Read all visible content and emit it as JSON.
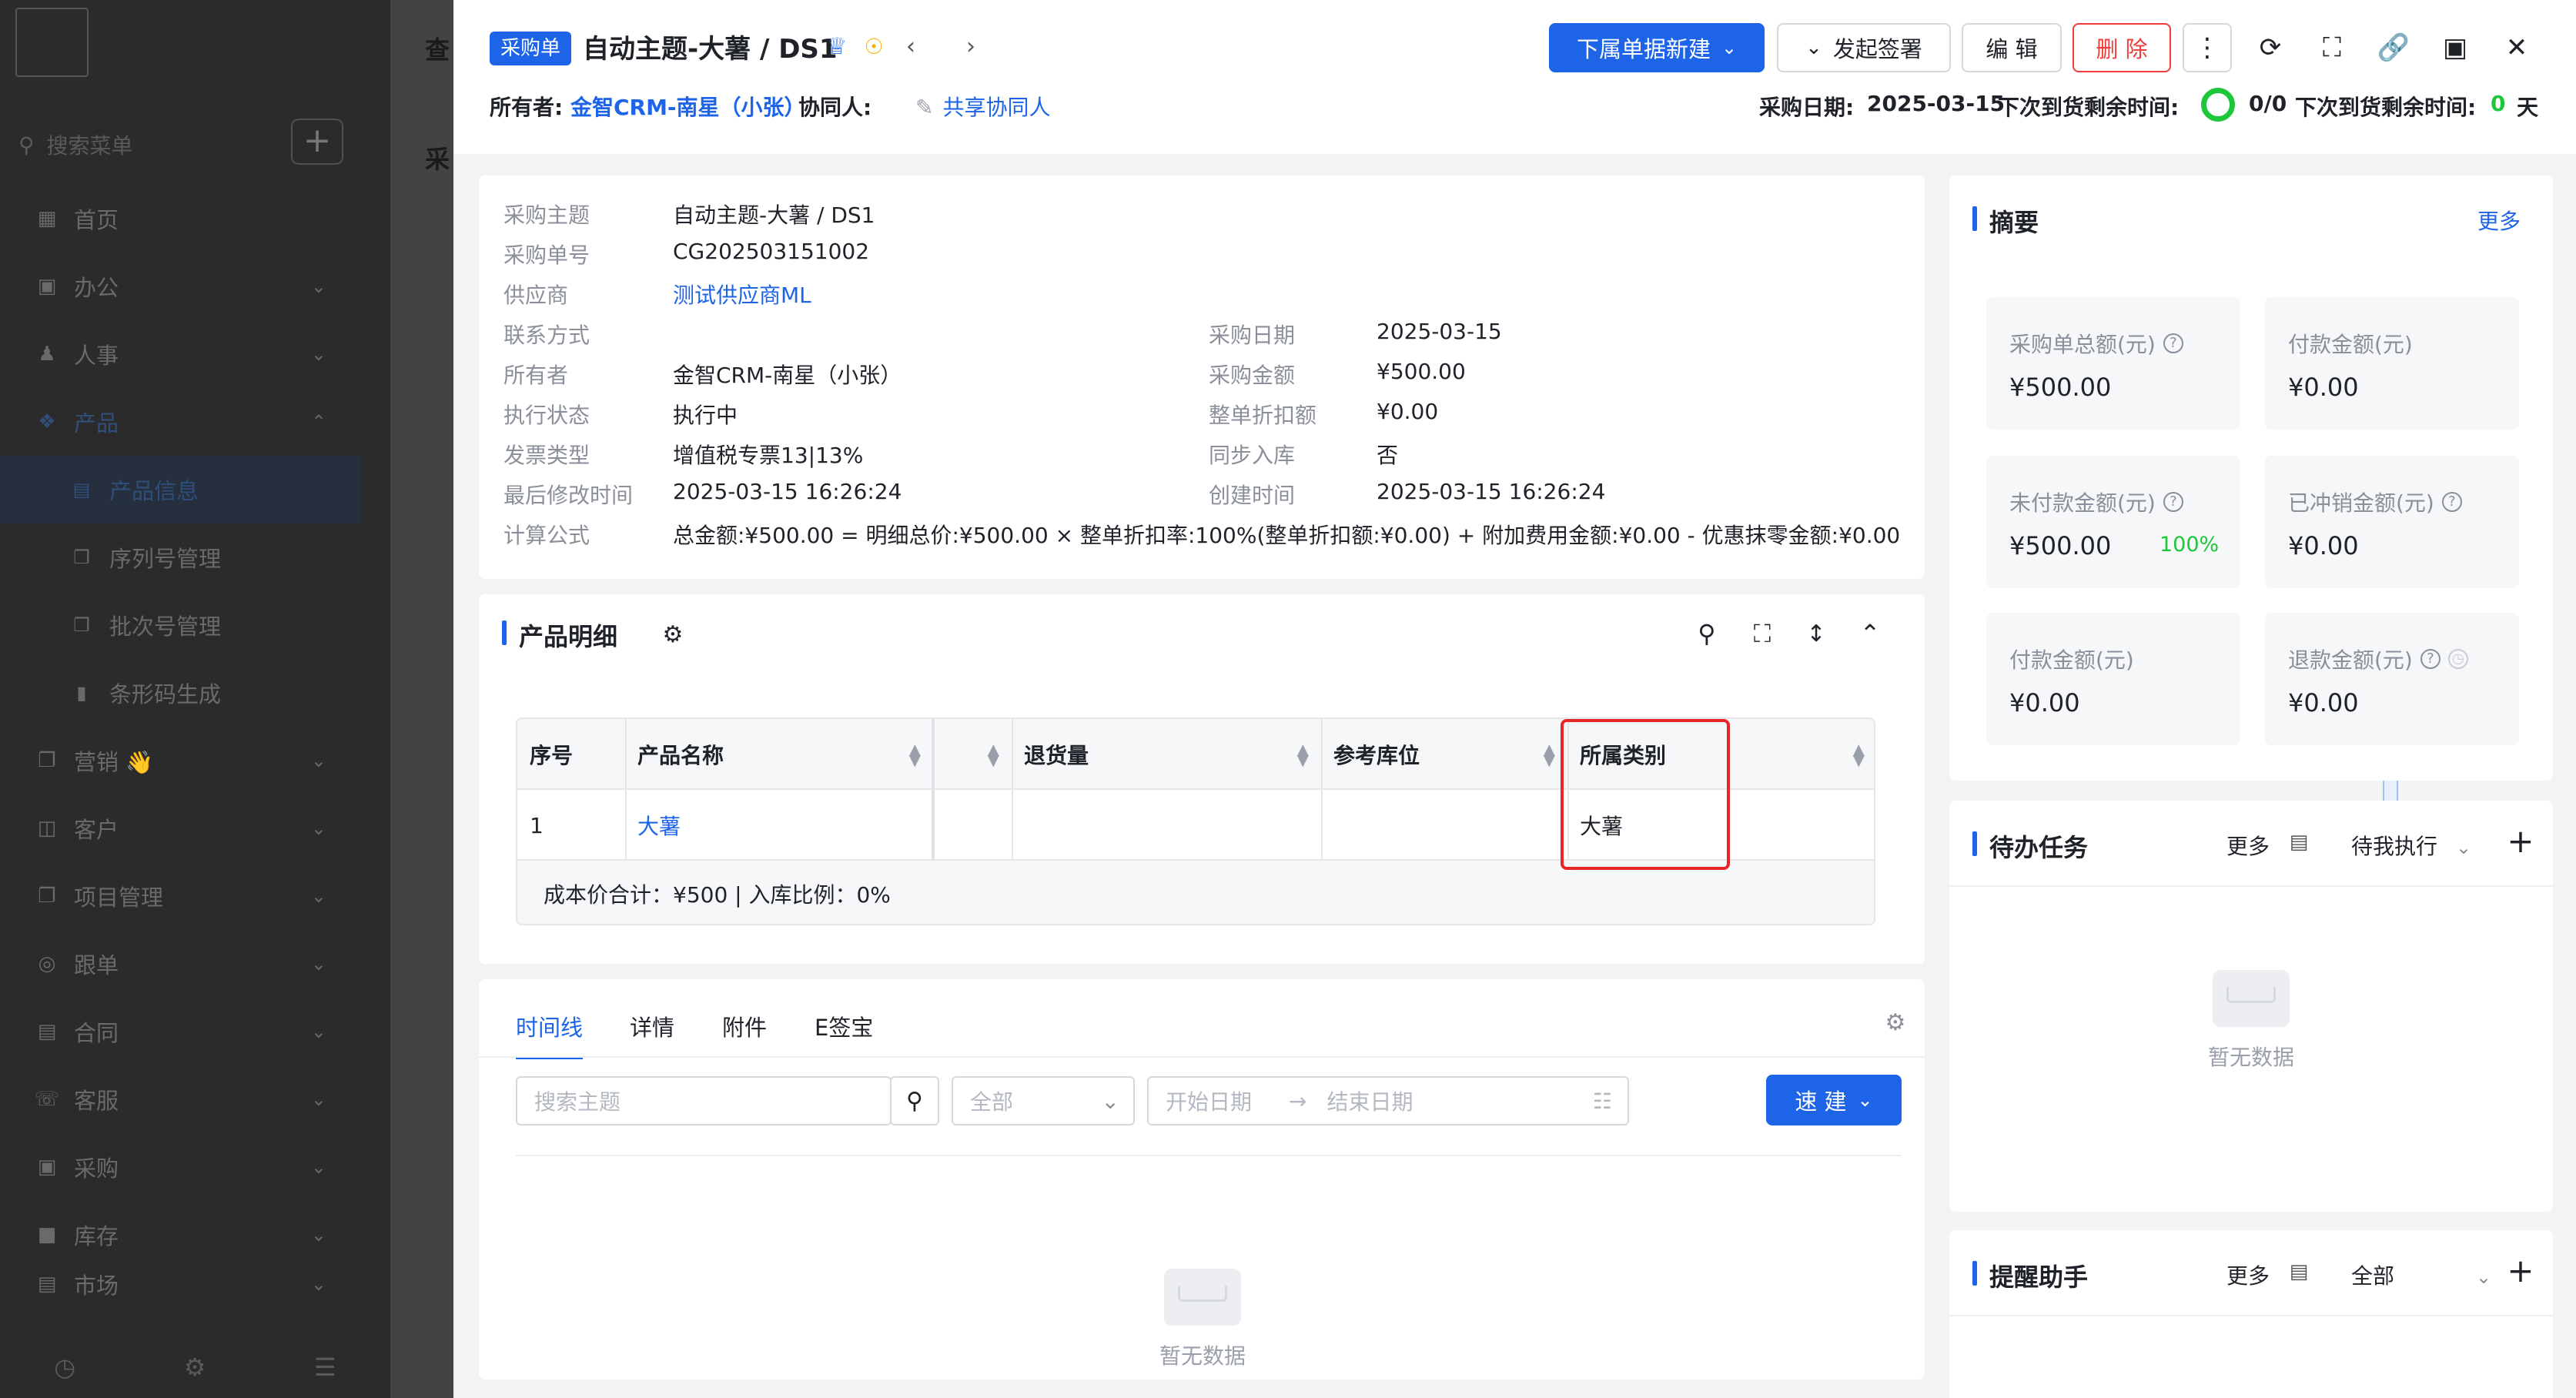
{
  "sidebar": {
    "search_placeholder": "搜索菜单",
    "add_label": "+",
    "items": [
      {
        "label": "首页",
        "icon": "grid-icon"
      },
      {
        "label": "办公",
        "icon": "briefcase-icon"
      },
      {
        "label": "人事",
        "icon": "people-icon"
      },
      {
        "label": "产品",
        "icon": "cube-icon"
      },
      {
        "label": "营销 👋",
        "icon": "megaphone-icon"
      },
      {
        "label": "客户",
        "icon": "customer-icon"
      },
      {
        "label": "项目管理",
        "icon": "project-icon"
      },
      {
        "label": "跟单",
        "icon": "follow-icon"
      },
      {
        "label": "合同",
        "icon": "contract-icon"
      },
      {
        "label": "客服",
        "icon": "service-icon"
      },
      {
        "label": "采购",
        "icon": "purchase-icon"
      },
      {
        "label": "库存",
        "icon": "warehouse-icon"
      },
      {
        "label": "市场",
        "icon": "market-icon"
      }
    ],
    "sub_items": [
      {
        "label": "产品信息"
      },
      {
        "label": "序列号管理"
      },
      {
        "label": "批次号管理"
      },
      {
        "label": "条形码生成"
      }
    ]
  },
  "background": {
    "strip_1": "查",
    "strip_2": "采"
  },
  "header": {
    "badge": "采购单",
    "title": "自动主题-大薯 / DS1",
    "btn_new": "下属单据新建",
    "btn_sign": "发起签署",
    "btn_edit": "编 辑",
    "btn_delete": "删 除",
    "owner_label": "所有者:",
    "owner_value": "金智CRM-南星（小张）",
    "collab_label": "协同人:",
    "share_label": "共享协同人",
    "date_label": "采购日期:",
    "date_value": "2025-03-15",
    "remain_label_1": "下次到货剩余时间:",
    "ratio_value": "0/0",
    "remain_label_2": "下次到货剩余时间:",
    "days_value": "0",
    "days_unit": "天"
  },
  "info": {
    "left": [
      {
        "label": "采购主题",
        "value": "自动主题-大薯 / DS1"
      },
      {
        "label": "采购单号",
        "value": "CG202503151002"
      },
      {
        "label": "供应商",
        "value": "测试供应商ML"
      },
      {
        "label": "联系方式",
        "value": ""
      },
      {
        "label": "所有者",
        "value": "金智CRM-南星（小张）"
      },
      {
        "label": "执行状态",
        "value": "执行中"
      },
      {
        "label": "发票类型",
        "value": "增值税专票13|13%"
      },
      {
        "label": "最后修改时间",
        "value": "2025-03-15 16:26:24"
      },
      {
        "label": "计算公式",
        "value": "总金额:¥500.00 = 明细总价:¥500.00 × 整单折扣率:100%(整单折扣额:¥0.00) + 附加费用金额:¥0.00 - 优惠抹零金额:¥0.00"
      }
    ],
    "right": [
      {
        "label": "采购日期",
        "value": "2025-03-15"
      },
      {
        "label": "采购金额",
        "value": "¥500.00"
      },
      {
        "label": "整单折扣额",
        "value": "¥0.00"
      },
      {
        "label": "同步入库",
        "value": "否"
      },
      {
        "label": "创建时间",
        "value": "2025-03-15 16:26:24"
      }
    ]
  },
  "products": {
    "title": "产品明细",
    "columns": [
      "序号",
      "产品名称",
      "",
      "退货量",
      "参考库位",
      "所属类别"
    ],
    "rows": [
      {
        "index": "1",
        "name": "大薯",
        "blank": "",
        "returns": "",
        "location": "",
        "category": "大薯"
      }
    ],
    "footer": "成本价合计：¥500 | 入库比例：0%"
  },
  "timeline": {
    "tabs": [
      "时间线",
      "详情",
      "附件",
      "E签宝"
    ],
    "search_placeholder": "搜索主题",
    "filter_value": "全部",
    "start_placeholder": "开始日期",
    "end_placeholder": "结束日期",
    "quick_btn": "速 建",
    "empty_text": "暂无数据"
  },
  "summary": {
    "title": "摘要",
    "more": "更多",
    "stats": [
      {
        "label": "采购单总额(元)",
        "value": "¥500.00",
        "pct": ""
      },
      {
        "label": "付款金额(元)",
        "value": "¥0.00",
        "pct": ""
      },
      {
        "label": "未付款金额(元)",
        "value": "¥500.00",
        "pct": "100%"
      },
      {
        "label": "已冲销金额(元)",
        "value": "¥0.00",
        "pct": ""
      },
      {
        "label": "付款金额(元)",
        "value": "¥0.00",
        "pct": ""
      },
      {
        "label": "退款金额(元)",
        "value": "¥0.00",
        "pct": ""
      }
    ]
  },
  "tasks": {
    "title": "待办任务",
    "more": "更多",
    "filter": "待我执行",
    "empty_text": "暂无数据"
  },
  "reminder": {
    "title": "提醒助手",
    "more": "更多",
    "filter": "全部"
  },
  "colors": {
    "primary": "#1d64e8",
    "danger": "#f23c3c",
    "success": "#1ec739",
    "highlight": "#e8262a"
  }
}
